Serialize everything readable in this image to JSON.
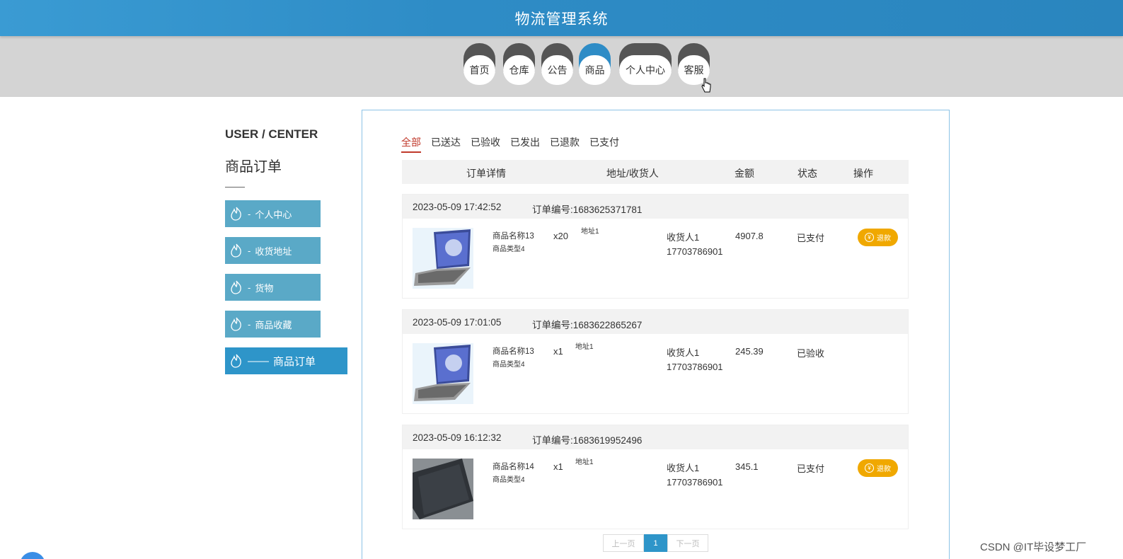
{
  "header": {
    "title": "物流管理系统"
  },
  "nav": {
    "items": [
      {
        "label": "首页"
      },
      {
        "label": "仓库"
      },
      {
        "label": "公告"
      },
      {
        "label": "商品"
      },
      {
        "label": "个人中心"
      },
      {
        "label": "客服"
      }
    ],
    "active": "商品"
  },
  "sidebar": {
    "title": "USER / CENTER",
    "subtitle": "商品订单",
    "items": [
      {
        "label": "个人中心",
        "sep": "-"
      },
      {
        "label": "收货地址",
        "sep": "-"
      },
      {
        "label": "货物",
        "sep": "-"
      },
      {
        "label": "商品收藏",
        "sep": "-"
      },
      {
        "label": "商品订单",
        "sep": "——"
      }
    ],
    "active": "商品订单"
  },
  "tabs": [
    {
      "label": "全部"
    },
    {
      "label": "已送达"
    },
    {
      "label": "已验收"
    },
    {
      "label": "已发出"
    },
    {
      "label": "已退款"
    },
    {
      "label": "已支付"
    }
  ],
  "table_header": {
    "details": "订单详情",
    "address": "地址/收货人",
    "amount": "金额",
    "status": "状态",
    "action": "操作"
  },
  "orders": [
    {
      "date": "2023-05-09 17:42:52",
      "order_no": "订单编号:1683625371781",
      "product_name": "商品名称13",
      "product_type": "商品类型4",
      "qty": "x20",
      "address": "地址1",
      "receiver": "收货人1",
      "phone": "17703786901",
      "amount": "4907.8",
      "status": "已支付",
      "action": "退款",
      "image": "laptop-icon"
    },
    {
      "date": "2023-05-09 17:01:05",
      "order_no": "订单编号:1683622865267",
      "product_name": "商品名称13",
      "product_type": "商品类型4",
      "qty": "x1",
      "address": "地址1",
      "receiver": "收货人1",
      "phone": "17703786901",
      "amount": "245.39",
      "status": "已验收",
      "action": "",
      "image": "laptop-icon"
    },
    {
      "date": "2023-05-09 16:12:32",
      "order_no": "订单编号:1683619952496",
      "product_name": "商品名称14",
      "product_type": "商品类型4",
      "qty": "x1",
      "address": "地址1",
      "receiver": "收货人1",
      "phone": "17703786901",
      "amount": "345.1",
      "status": "已支付",
      "action": "退款",
      "image": "closed-laptop-icon"
    }
  ],
  "pager": {
    "prev": "上一页",
    "page": "1",
    "next": "下一页"
  },
  "watermark": "CSDN @IT毕设梦工厂",
  "colors": {
    "primary": "#2e8cc6",
    "sidebar": "#5aa9c7",
    "refund": "#f0a800",
    "active_tab": "#c0392b"
  }
}
